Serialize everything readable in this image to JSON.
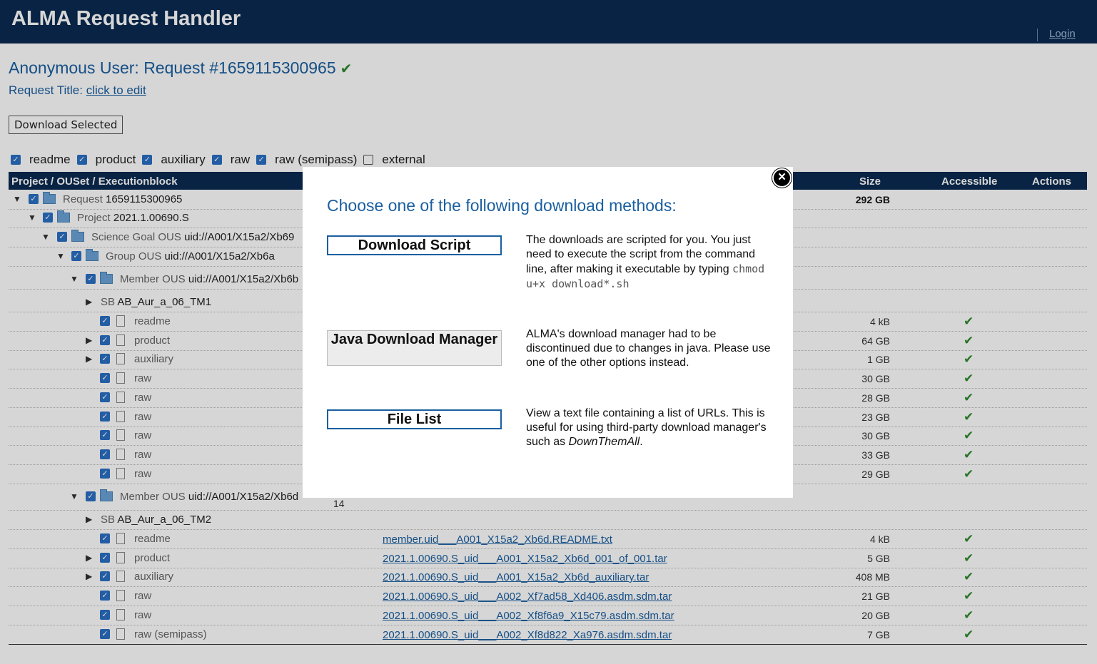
{
  "header": {
    "app_title": "ALMA Request Handler",
    "login": "Login"
  },
  "request": {
    "title": "Anonymous User: Request #1659115300965",
    "check": "✔",
    "title_label": "Request Title:",
    "title_link": "click to edit"
  },
  "toolbar": {
    "download_selected": "Download Selected"
  },
  "filters": [
    {
      "label": "readme",
      "checked": true
    },
    {
      "label": "product",
      "checked": true
    },
    {
      "label": "auxiliary",
      "checked": true
    },
    {
      "label": "raw",
      "checked": true
    },
    {
      "label": "raw (semipass)",
      "checked": true
    },
    {
      "label": "external",
      "checked": false
    }
  ],
  "table": {
    "columns": {
      "project": "Project / OUSet / Executionblock",
      "size": "Size",
      "accessible": "Accessible",
      "actions": "Actions"
    },
    "rows": [
      {
        "type": "Request",
        "name": "1659115300965",
        "size": "292 GB"
      },
      {
        "type": "Project",
        "name": "2021.1.00690.S"
      },
      {
        "type": "Science Goal OUS",
        "name": "uid://A001/X15a2/Xb69"
      },
      {
        "type": "Group OUS",
        "name": "uid://A001/X15a2/Xb6a"
      },
      {
        "type": "Member OUS",
        "name": "uid://A001/X15a2/Xb6b"
      },
      {
        "type": "SB",
        "name": "AB_Aur_a_06_TM1"
      },
      {
        "label": "readme",
        "size": "4 kB",
        "acc": "✔"
      },
      {
        "label": "product",
        "size": "64 GB",
        "acc": "✔"
      },
      {
        "label": "auxiliary",
        "size": "1 GB",
        "acc": "✔"
      },
      {
        "label": "raw",
        "size": "30 GB",
        "acc": "✔"
      },
      {
        "label": "raw",
        "size": "28 GB",
        "acc": "✔"
      },
      {
        "label": "raw",
        "size": "23 GB",
        "acc": "✔"
      },
      {
        "label": "raw",
        "size": "30 GB",
        "acc": "✔"
      },
      {
        "label": "raw",
        "size": "33 GB",
        "acc": "✔"
      },
      {
        "label": "raw",
        "size": "29 GB",
        "acc": "✔"
      },
      {
        "type": "Member OUS",
        "name": "uid://A001/X15a2/Xb6d",
        "extra": "14"
      },
      {
        "type": "SB",
        "name": "AB_Aur_a_06_TM2"
      },
      {
        "label": "readme",
        "file": "member.uid___A001_X15a2_Xb6d.README.txt",
        "size": "4 kB",
        "acc": "✔"
      },
      {
        "label": "product",
        "file": "2021.1.00690.S_uid___A001_X15a2_Xb6d_001_of_001.tar",
        "size": "5 GB",
        "acc": "✔"
      },
      {
        "label": "auxiliary",
        "file": "2021.1.00690.S_uid___A001_X15a2_Xb6d_auxiliary.tar",
        "size": "408 MB",
        "acc": "✔"
      },
      {
        "label": "raw",
        "file": "2021.1.00690.S_uid___A002_Xf7ad58_Xd406.asdm.sdm.tar",
        "size": "21 GB",
        "acc": "✔"
      },
      {
        "label": "raw",
        "file": "2021.1.00690.S_uid___A002_Xf8f6a9_X15c79.asdm.sdm.tar",
        "size": "20 GB",
        "acc": "✔"
      },
      {
        "label": "raw (semipass)",
        "file": "2021.1.00690.S_uid___A002_Xf8d822_Xa976.asdm.sdm.tar",
        "size": "7 GB",
        "acc": "✔"
      }
    ]
  },
  "modal": {
    "close": "×",
    "title": "Choose one of the following download methods:",
    "options": [
      {
        "button": "Download Script",
        "desc_pre": "The downloads are scripted for you. You just need to execute the script from the command line, after making it executable by typing ",
        "code": "chmod u+x download*.sh"
      },
      {
        "button": "Java Download Manager",
        "desc": "ALMA's download manager had to be discontinued due to changes in java. Please use one of the other options instead."
      },
      {
        "button": "File List",
        "desc_pre": "View a text file containing a list of URLs. This is useful for using third-party download manager's such as ",
        "em": "DownThemAll",
        "desc_post": "."
      }
    ]
  }
}
